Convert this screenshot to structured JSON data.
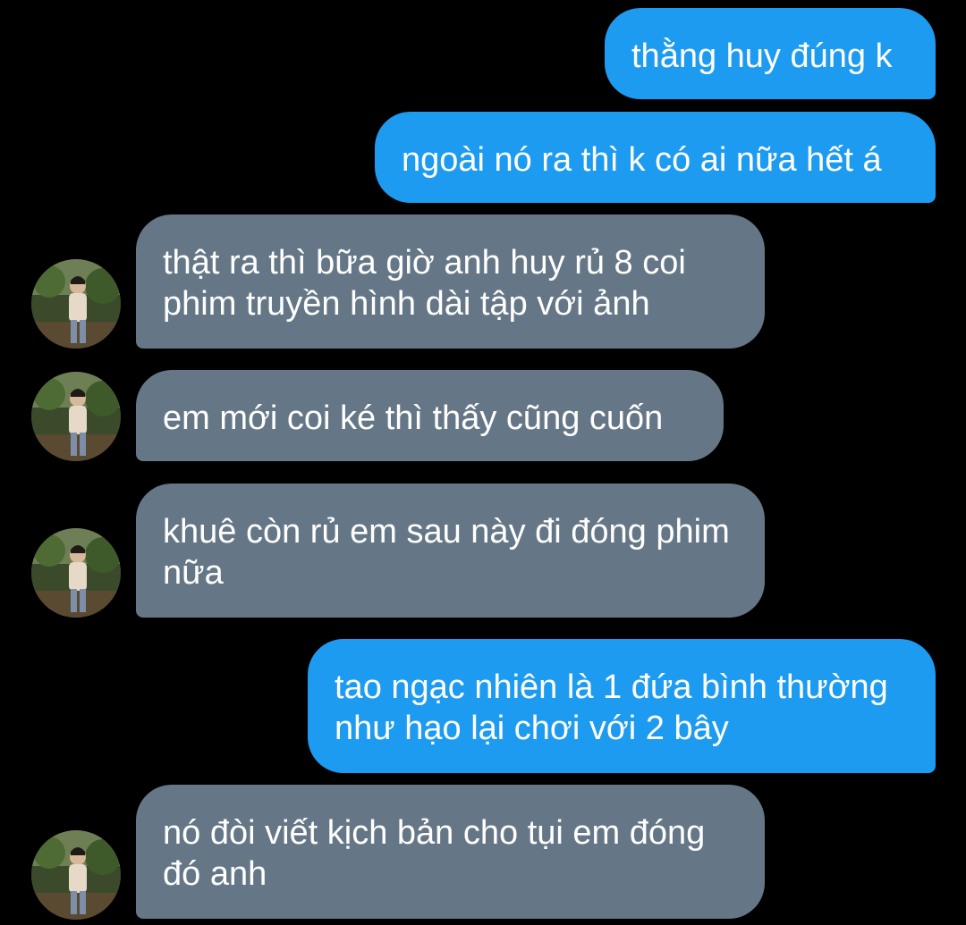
{
  "conversation": {
    "messages": [
      {
        "direction": "out",
        "text": "thằng huy đúng k"
      },
      {
        "direction": "out",
        "text": "ngoài nó ra thì k có ai nữa hết á"
      },
      {
        "direction": "in",
        "text": "thật ra thì bữa giờ anh huy rủ 8 coi phim truyền hình dài tập với ảnh"
      },
      {
        "direction": "in",
        "text": "em mới coi ké thì thấy cũng cuốn"
      },
      {
        "direction": "in",
        "text": "khuê còn rủ em sau này đi đóng phim nữa"
      },
      {
        "direction": "out",
        "text": "tao ngạc nhiên là 1 đứa bình thường như hạo lại chơi với 2 bây"
      },
      {
        "direction": "in",
        "text": "nó đòi viết kịch bản cho tụi em đóng đó anh"
      }
    ]
  },
  "colors": {
    "background": "#000000",
    "outgoing_bubble": "#1d9bf0",
    "incoming_bubble": "#657786",
    "text": "#ffffff"
  }
}
